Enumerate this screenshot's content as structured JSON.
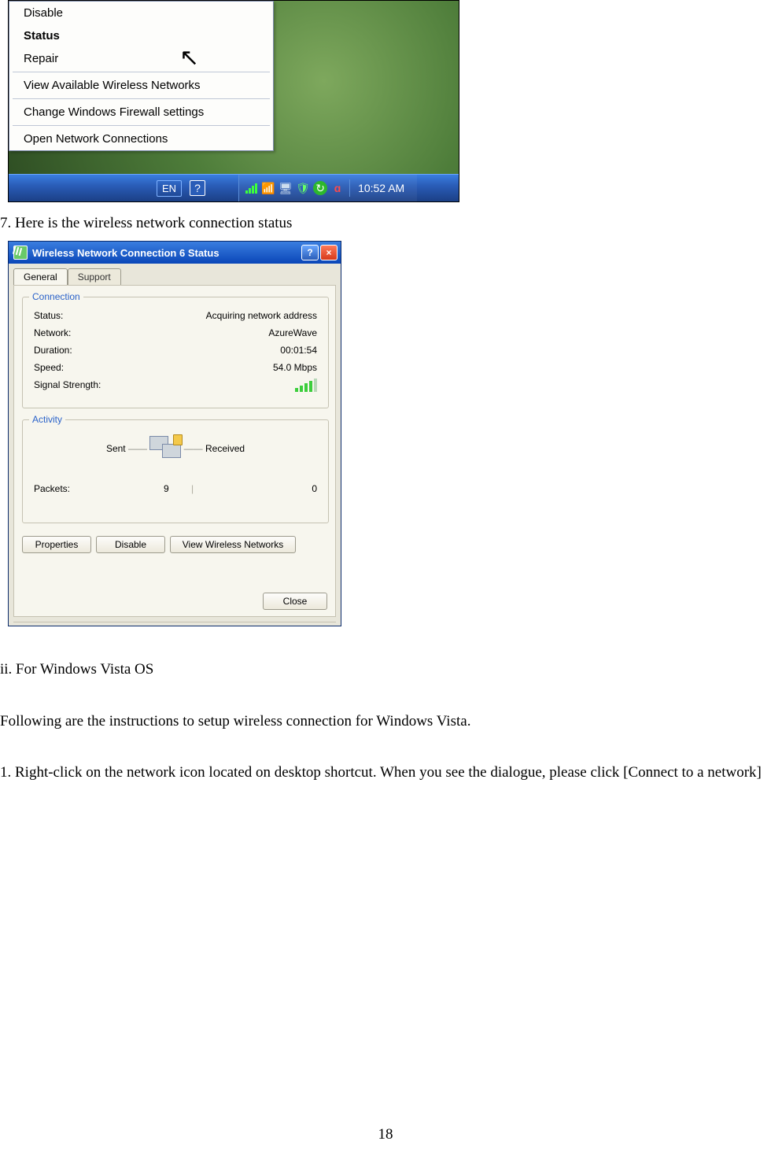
{
  "context_menu": {
    "items": [
      "Disable",
      "Status",
      "Repair",
      "View Available Wireless Networks",
      "Change Windows Firewall settings",
      "Open Network Connections"
    ],
    "bold_index": 1
  },
  "taskbar": {
    "lang": "EN",
    "clock": "10:52 AM"
  },
  "body_text": {
    "step7": "7. Here is the wireless network connection status",
    "sec_ii": "ii. For Windows Vista OS",
    "vista_intro": "Following are the instructions to setup wireless connection for Windows Vista.",
    "step1": "1. Right-click on the network icon located on desktop shortcut. When you see the dialogue, please click [Connect to a network]"
  },
  "status_dialog": {
    "title": "Wireless Network Connection 6 Status",
    "tabs": {
      "general": "General",
      "support": "Support"
    },
    "groups": {
      "connection": "Connection",
      "activity": "Activity"
    },
    "fields": {
      "status_label": "Status:",
      "status_value": "Acquiring network address",
      "network_label": "Network:",
      "network_value": "AzureWave",
      "duration_label": "Duration:",
      "duration_value": "00:01:54",
      "speed_label": "Speed:",
      "speed_value": "54.0 Mbps",
      "signal_label": "Signal Strength:"
    },
    "activity": {
      "sent_label": "Sent",
      "received_label": "Received",
      "packets_label": "Packets:",
      "sent_value": "9",
      "received_value": "0"
    },
    "buttons": {
      "properties": "Properties",
      "disable": "Disable",
      "view": "View Wireless Networks",
      "close": "Close"
    }
  },
  "page_number": "18"
}
